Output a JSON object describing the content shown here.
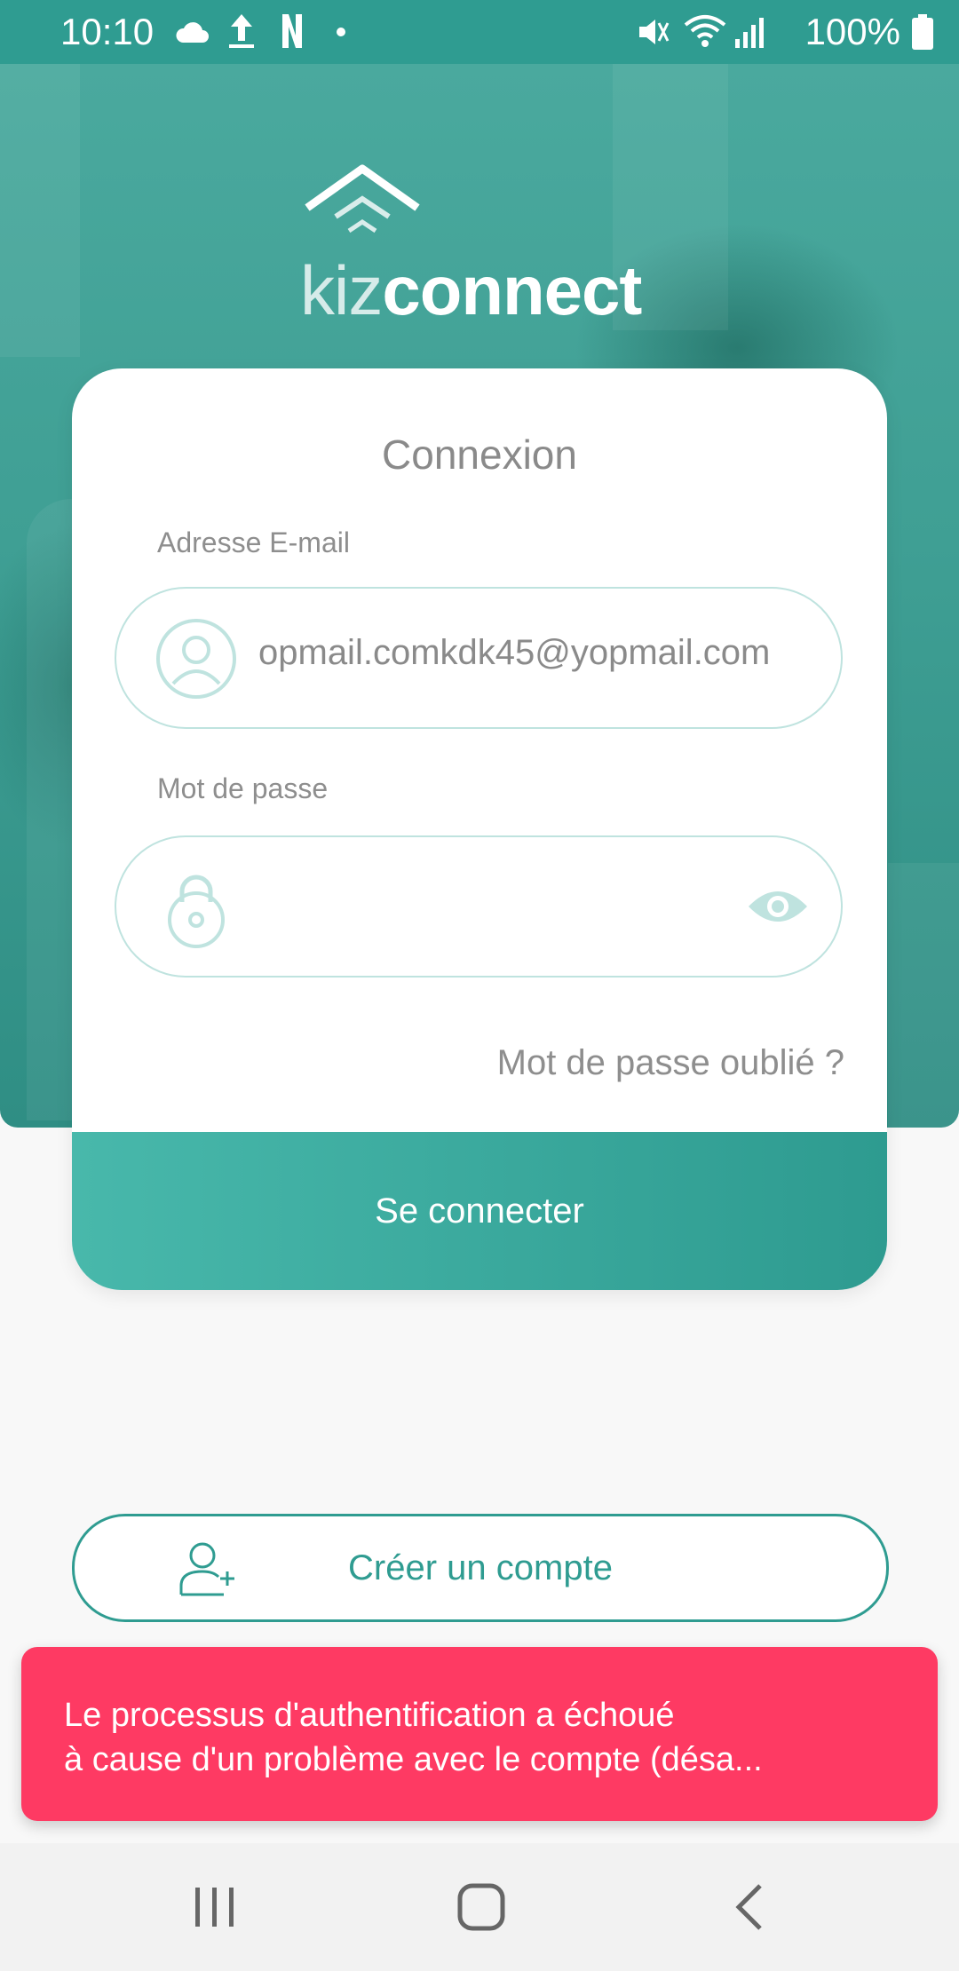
{
  "status_bar": {
    "time": "10:10",
    "battery": "100%",
    "icons": [
      "cloud-icon",
      "upload-icon",
      "netflix-icon",
      "dot-icon",
      "mute-icon",
      "wifi-icon",
      "signal-icon",
      "battery-icon"
    ]
  },
  "brand": {
    "logo_part1": "kiz",
    "logo_part2": "connect"
  },
  "login_card": {
    "title": "Connexion",
    "email_label": "Adresse E-mail",
    "email_value": "opmail.comkdk45@yopmail.com",
    "password_label": "Mot de passe",
    "password_value": "",
    "forgot_password": "Mot de passe oublié ?",
    "submit_label": "Se connecter"
  },
  "create_account": {
    "label": "Créer un compte"
  },
  "toast": {
    "line1": "Le processus d'authentification a échoué",
    "line2": "à cause d'un problème avec le compte (désa..."
  },
  "colors": {
    "brand": "#2f9c91",
    "error": "#fe3a63",
    "field_border": "#bfe3df"
  }
}
